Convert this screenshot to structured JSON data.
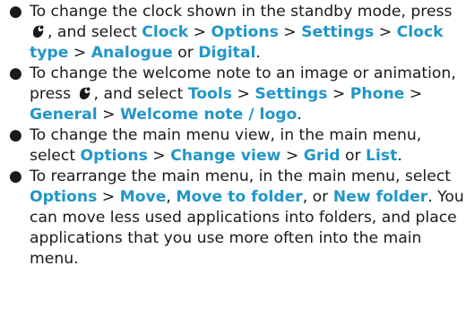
{
  "colors": {
    "text": "#1a1a1a",
    "keyword": "#2196c8"
  },
  "icons": {
    "menu_key": "menu-key-icon"
  },
  "tips": [
    {
      "segments": [
        {
          "t": "text",
          "v": "To change the clock shown in the standby mode, press "
        },
        {
          "t": "icon",
          "v": "menu-key-icon"
        },
        {
          "t": "text",
          "v": ", and select "
        },
        {
          "t": "kw",
          "v": "Clock"
        },
        {
          "t": "text",
          "v": " > "
        },
        {
          "t": "kw",
          "v": "Options"
        },
        {
          "t": "text",
          "v": " > "
        },
        {
          "t": "kw",
          "v": "Settings"
        },
        {
          "t": "text",
          "v": " > "
        },
        {
          "t": "kw",
          "v": "Clock type"
        },
        {
          "t": "text",
          "v": " > "
        },
        {
          "t": "kw",
          "v": "Analogue"
        },
        {
          "t": "text",
          "v": " or "
        },
        {
          "t": "kw",
          "v": "Digital"
        },
        {
          "t": "text",
          "v": "."
        }
      ]
    },
    {
      "segments": [
        {
          "t": "text",
          "v": "To change the welcome note to an image or animation, press "
        },
        {
          "t": "icon",
          "v": "menu-key-icon"
        },
        {
          "t": "text",
          "v": ", and select "
        },
        {
          "t": "kw",
          "v": "Tools"
        },
        {
          "t": "text",
          "v": " > "
        },
        {
          "t": "kw",
          "v": "Settings"
        },
        {
          "t": "text",
          "v": " > "
        },
        {
          "t": "kw",
          "v": "Phone"
        },
        {
          "t": "text",
          "v": " > "
        },
        {
          "t": "kw",
          "v": "General"
        },
        {
          "t": "text",
          "v": " > "
        },
        {
          "t": "kw",
          "v": "Welcome note / logo"
        },
        {
          "t": "text",
          "v": "."
        }
      ]
    },
    {
      "segments": [
        {
          "t": "text",
          "v": "To change the main menu view, in the main menu, select "
        },
        {
          "t": "kw",
          "v": "Options"
        },
        {
          "t": "text",
          "v": " > "
        },
        {
          "t": "kw",
          "v": "Change view"
        },
        {
          "t": "text",
          "v": " > "
        },
        {
          "t": "kw",
          "v": "Grid"
        },
        {
          "t": "text",
          "v": " or "
        },
        {
          "t": "kw",
          "v": "List"
        },
        {
          "t": "text",
          "v": "."
        }
      ]
    },
    {
      "segments": [
        {
          "t": "text",
          "v": "To rearrange the main menu, in the main menu, select "
        },
        {
          "t": "kw",
          "v": "Options"
        },
        {
          "t": "text",
          "v": " > "
        },
        {
          "t": "kw",
          "v": "Move"
        },
        {
          "t": "text",
          "v": ", "
        },
        {
          "t": "kw",
          "v": "Move to folder"
        },
        {
          "t": "text",
          "v": ", or "
        },
        {
          "t": "kw",
          "v": "New folder"
        },
        {
          "t": "text",
          "v": ". You can move less used applications into folders, and place applications that you use more often into the main menu."
        }
      ]
    }
  ]
}
